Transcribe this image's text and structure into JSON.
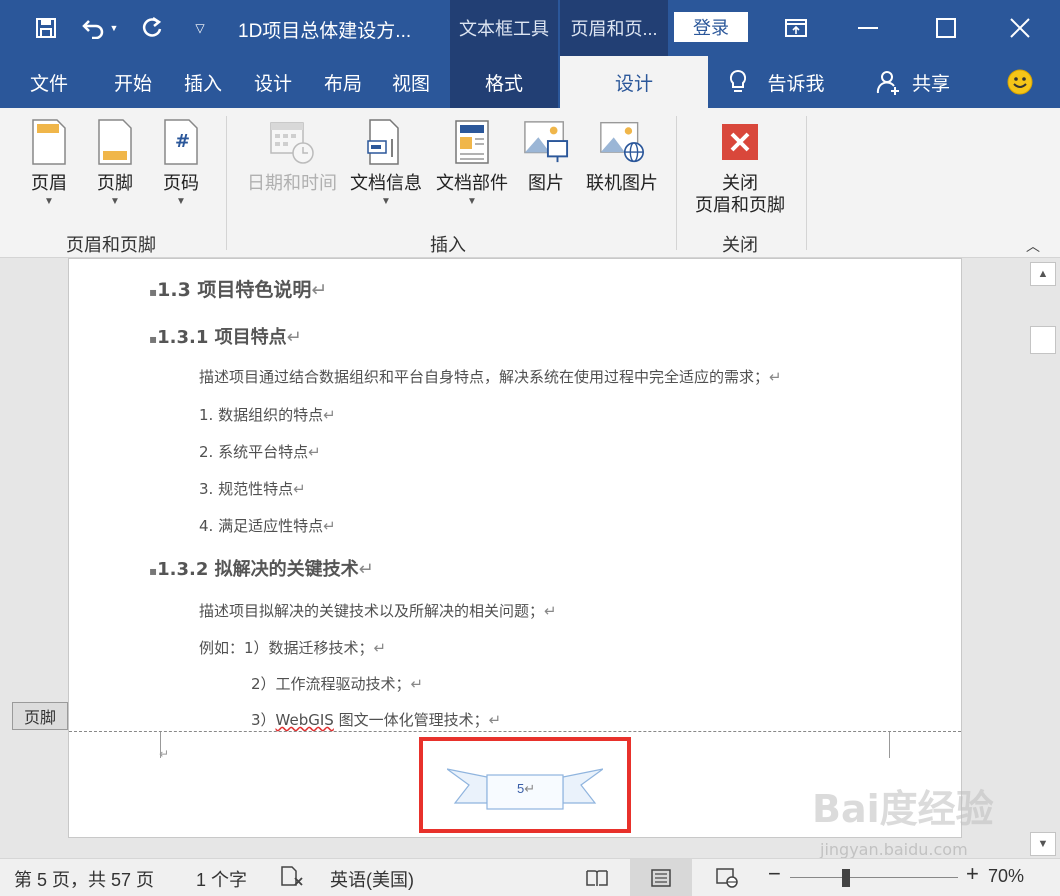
{
  "titlebar": {
    "doc_title": "1D项目总体建设方...",
    "ctx_tab_textbox": "文本框工具",
    "ctx_tab_headerfooter": "页眉和页...",
    "login": "登录"
  },
  "tabs": {
    "file": "文件",
    "home": "开始",
    "insert": "插入",
    "design": "设计",
    "layout": "布局",
    "view": "视图",
    "format": "格式",
    "hf_design": "设计",
    "tellme": "告诉我",
    "share": "共享"
  },
  "ribbon": {
    "header": "页眉",
    "footer": "页脚",
    "pagenum": "页码",
    "group_hf": "页眉和页脚",
    "datetime": "日期和时间",
    "docinfo": "文档信息",
    "quickparts": "文档部件",
    "picture": "图片",
    "online_picture": "联机图片",
    "group_insert": "插入",
    "close_line1": "关闭",
    "close_line2": "页眉和页脚",
    "group_close": "关闭"
  },
  "document": {
    "h_13": "1.3  项目特色说明",
    "h_131": "1.3.1  项目特点",
    "p1": "描述项目通过结合数据组织和平台自身特点，解决系统在使用过程中完全适应的需求；",
    "li1": "1.  数据组织的特点",
    "li2": "2.  系统平台特点",
    "li3": "3.  规范性特点",
    "li4": "4.  满足适应性特点",
    "h_132": "1.3.2  拟解决的关键技术",
    "p2": "描述项目拟解决的关键技术以及所解决的相关问题；",
    "p3": "例如：1）数据迁移技术；",
    "p4": "2）工作流程驱动技术；",
    "p5_prefix": "3）",
    "p5_word": "WebGIS",
    "p5_suffix": " 图文一体化管理技术；",
    "footer_label": "页脚",
    "page_number": "5"
  },
  "statusbar": {
    "page_info": "第 5 页，共 57 页",
    "word_count": "1 个字",
    "language": "英语(美国)",
    "zoom": "70%",
    "zoom_level_percent": 70
  },
  "watermark": {
    "main": "Bai度经验",
    "sub": "jingyan.baidu.com"
  },
  "colors": {
    "accent": "#2b579a",
    "highlight_box": "#e8312b"
  }
}
